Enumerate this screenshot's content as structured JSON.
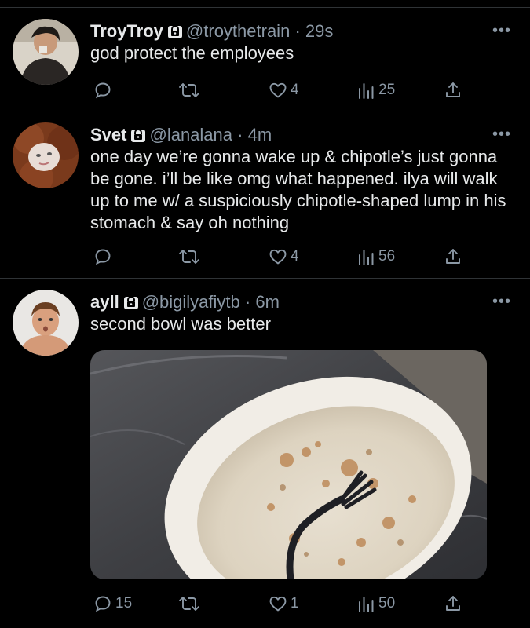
{
  "tweets": [
    {
      "display_name": "TroyTroy",
      "handle": "@troythetrain",
      "dot": "·",
      "time": "29s",
      "text": "god protect the employees",
      "replies": "",
      "retweets": "",
      "likes": "4",
      "views": "25",
      "more": "•••"
    },
    {
      "display_name": "Svet",
      "handle": "@lanalana",
      "dot": "·",
      "time": "4m",
      "text": "one day we’re gonna wake up & chipotle’s just gonna be gone. i’ll be like omg what happened. ilya will walk up to me w/ a suspiciously chipotle-shaped lump in his stomach & say oh nothing",
      "replies": "",
      "retweets": "",
      "likes": "4",
      "views": "56",
      "more": "•••"
    },
    {
      "display_name": "ayll",
      "handle": "@bigilyafiytb",
      "dot": "·",
      "time": "6m",
      "text": "second bowl was better",
      "replies": "15",
      "retweets": "",
      "likes": "1",
      "views": "50",
      "more": "•••"
    }
  ],
  "colors": {
    "background": "#000000",
    "text": "#e7e9ea",
    "secondary": "#8b98a5",
    "divider": "#2f3336"
  }
}
